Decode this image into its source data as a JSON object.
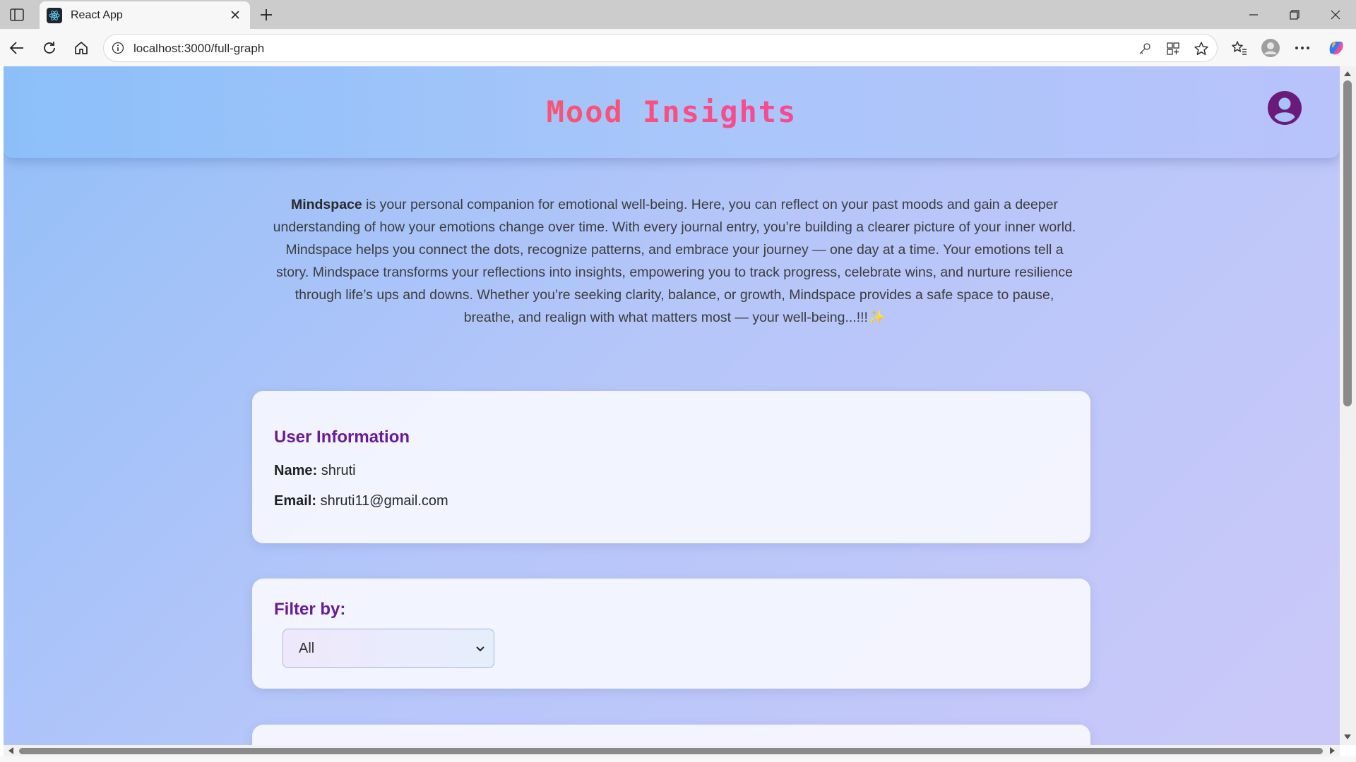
{
  "browser": {
    "tab_title": "React App",
    "url": "localhost:3000/full-graph",
    "icons": {
      "sidebar_toggle": "sidebar-toggle-icon",
      "favicon": "react-logo-icon",
      "tab_close": "close-icon",
      "new_tab": "plus-icon",
      "back": "back-arrow-icon",
      "refresh": "refresh-icon",
      "home": "home-icon",
      "site_info": "info-icon",
      "password": "key-icon",
      "apps": "apps-icon",
      "favorite": "star-icon",
      "favorites_list": "favorites-icon",
      "profile": "profile-icon",
      "menu": "more-icon",
      "copilot": "copilot-icon"
    }
  },
  "header": {
    "title": "Mood Insights",
    "profile_icon": "user-circle-icon"
  },
  "intro": {
    "brand": "Mindspace",
    "text": " is your personal companion for emotional well-being. Here, you can reflect on your past moods and gain a deeper understanding of how your emotions change over time. With every journal entry, you’re building a clearer picture of your inner world. Mindspace helps you connect the dots, recognize patterns, and embrace your journey — one day at a time. Your emotions tell a story. Mindspace transforms your reflections into insights, empowering you to track progress, celebrate wins, and nurture resilience through life’s ups and downs. Whether you’re seeking clarity, balance, or growth, Mindspace provides a safe space to pause, breathe, and realign with what matters most — your well-being...!!!✨"
  },
  "user_info": {
    "heading": "User Information",
    "name_label": "Name:",
    "name_value": "shruti",
    "email_label": "Email:",
    "email_value": "shruti11@gmail.com"
  },
  "filter": {
    "label": "Filter by:",
    "selected": "All"
  },
  "colors": {
    "heading_purple": "#6a1b9a",
    "title_orange": "#fb6a2a",
    "title_pink": "#f74c8c",
    "profile_purple": "#6a1b7a"
  }
}
